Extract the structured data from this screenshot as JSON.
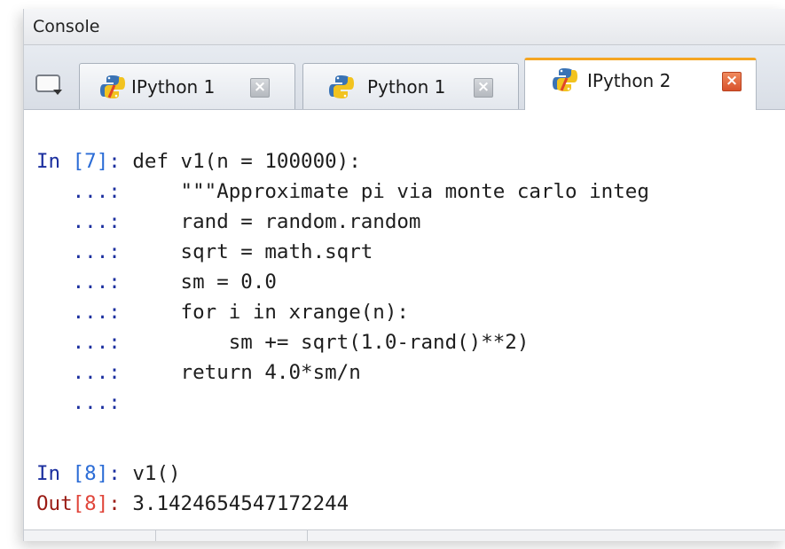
{
  "window": {
    "title": "Console"
  },
  "tabs": [
    {
      "label": "IPython 1",
      "active": false,
      "icon": "python-logo-icon",
      "close": "×"
    },
    {
      "label": "Python 1",
      "active": false,
      "icon": "python-logo-icon",
      "close": "×"
    },
    {
      "label": "IPython 2",
      "active": true,
      "icon": "python-logo-icon",
      "close": "×"
    }
  ],
  "console": {
    "in7": {
      "label": "In ",
      "num": "[7]",
      "colon": ": ",
      "code": "def v1(n = 100000):"
    },
    "continuation_prompt": "   ...: ",
    "body_lines": [
      "    \"\"\"Approximate pi via monte carlo integ",
      "    rand = random.random",
      "    sqrt = math.sqrt",
      "    sm = 0.0",
      "    for i in xrange(n):",
      "        sm += sqrt(1.0-rand()**2)",
      "    return 4.0*sm/n",
      ""
    ],
    "in8": {
      "label": "In ",
      "num": "[8]",
      "colon": ": ",
      "code": "v1()"
    },
    "out8": {
      "label": "Out",
      "num": "[8]",
      "colon": ": ",
      "value": "3.1424654547172244"
    }
  },
  "colors": {
    "active_tab_accent": "#f5a623",
    "prompt_in": "#1b2f9f",
    "prompt_out": "#9a1b14",
    "close_active": "#d8522c"
  }
}
